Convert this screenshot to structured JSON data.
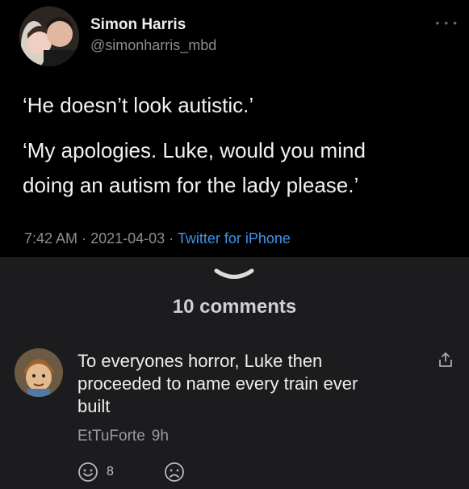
{
  "tweet": {
    "author_name": "Simon Harris",
    "author_handle": "@simonharris_mbd",
    "more_label": "• • •",
    "lines": [
      "‘He doesn’t look autistic.’",
      "‘My apologies. Luke, would you mind",
      "doing an autism for the lady please.’"
    ],
    "time": "7:42 AM",
    "separator": "·",
    "date": "2021-04-03",
    "source": "Twitter for iPhone"
  },
  "thread": {
    "comments_count_label": "10 comments",
    "comment": {
      "lines": [
        "To everyones horror, Luke then",
        "proceeded to name every train ever",
        "built"
      ],
      "author": "EtTuForte",
      "age": "9h",
      "reaction_count": "8"
    }
  },
  "colors": {
    "tweet_bg": "#000000",
    "thread_bg": "#1c1c1e",
    "link_blue": "#3d94e8",
    "muted_text": "#8b8d91"
  },
  "icons": {
    "chevron": "chevron-down-icon",
    "share": "share-icon",
    "happy": "smile-icon",
    "sad": "frown-icon"
  }
}
